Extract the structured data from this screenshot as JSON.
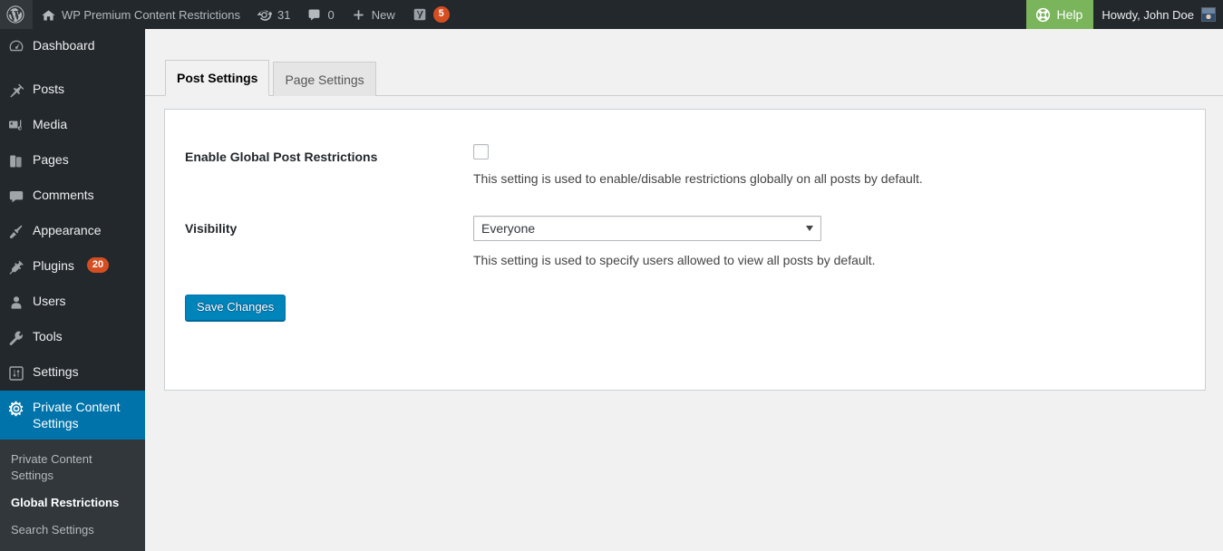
{
  "adminbar": {
    "wp_logo_icon": "wordpress-logo-icon",
    "site_home_icon": "home-icon",
    "site_name": "WP Premium Content Restrictions",
    "updates_icon": "updates-icon",
    "updates_count": "31",
    "comments_icon": "comment-bubble-icon",
    "comments_count": "0",
    "new_icon": "plus-icon",
    "new_label": "New",
    "yoast_icon": "yoast-seo-icon",
    "yoast_count": "5",
    "help_icon": "help-lifebuoy-icon",
    "help_label": "Help",
    "howdy_label": "Howdy, John Doe",
    "avatar_icon": "user-avatar",
    "bar_bg": "#23282d",
    "help_bg": "#7ab55c",
    "badge_bg": "#d54e21"
  },
  "sidebar": {
    "bg": "#23282d",
    "submenu_bg": "#32373c",
    "active_bg": "#0073aa",
    "items": [
      {
        "label": "Dashboard",
        "icon": "dashboard-icon",
        "current": false,
        "badge": ""
      },
      {
        "label": "Posts",
        "icon": "pin-icon",
        "current": false,
        "badge": ""
      },
      {
        "label": "Media",
        "icon": "media-icon",
        "current": false,
        "badge": ""
      },
      {
        "label": "Pages",
        "icon": "pages-icon",
        "current": false,
        "badge": ""
      },
      {
        "label": "Comments",
        "icon": "comment-bubble-icon",
        "current": false,
        "badge": ""
      },
      {
        "label": "Appearance",
        "icon": "paintbrush-icon",
        "current": false,
        "badge": ""
      },
      {
        "label": "Plugins",
        "icon": "plug-icon",
        "current": false,
        "badge": "20"
      },
      {
        "label": "Users",
        "icon": "user-icon",
        "current": false,
        "badge": ""
      },
      {
        "label": "Tools",
        "icon": "wrench-icon",
        "current": false,
        "badge": ""
      },
      {
        "label": "Settings",
        "icon": "sliders-icon",
        "current": false,
        "badge": ""
      },
      {
        "label": "Private Content Settings",
        "icon": "gear-icon",
        "current": true,
        "badge": ""
      }
    ],
    "submenu": [
      {
        "label": "Private Content Settings",
        "current": false
      },
      {
        "label": "Global Restrictions",
        "current": true
      },
      {
        "label": "Search Settings",
        "current": false
      }
    ]
  },
  "tabs": [
    {
      "label": "Post Settings",
      "active": true
    },
    {
      "label": "Page Settings",
      "active": false
    }
  ],
  "form": {
    "rows": [
      {
        "label": "Enable Global Post Restrictions",
        "control": "checkbox",
        "checked": false,
        "description": "This setting is used to enable/disable restrictions globally on all posts by default."
      },
      {
        "label": "Visibility",
        "control": "select",
        "value": "Everyone",
        "options": [
          "Everyone"
        ],
        "description": "This setting is used to specify users allowed to view all posts by default."
      }
    ],
    "submit_label": "Save Changes",
    "submit_bg": "#0085ba"
  }
}
